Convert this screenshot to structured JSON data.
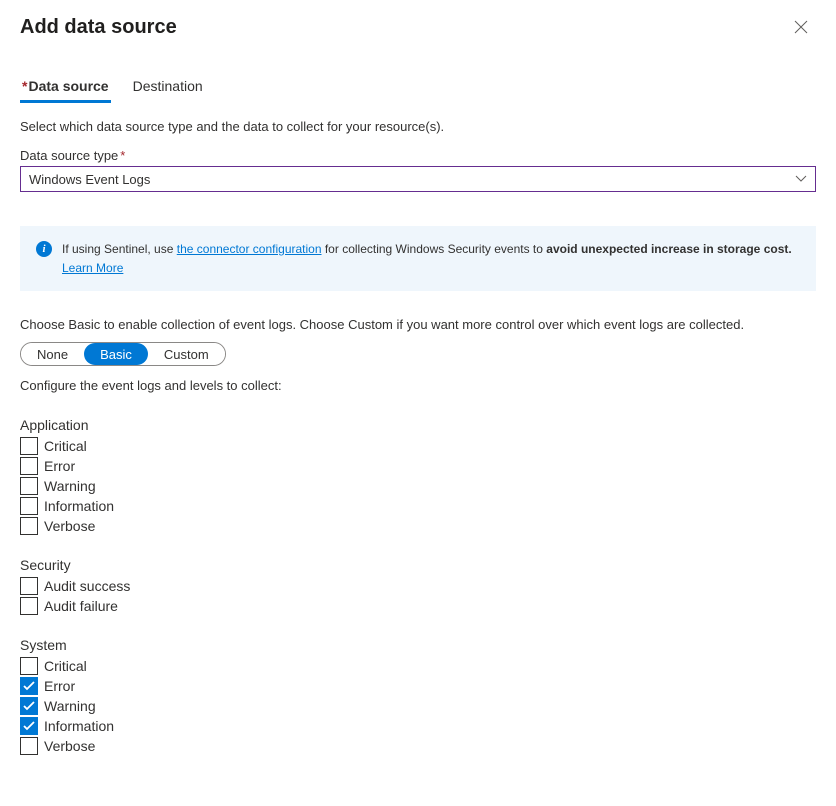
{
  "title": "Add data source",
  "tabs": {
    "data_source": "Data source",
    "destination": "Destination"
  },
  "helper_text": "Select which data source type and the data to collect for your resource(s).",
  "field_label": "Data source type",
  "required_mark": "*",
  "select_value": "Windows Event Logs",
  "info": {
    "prefix": "If using Sentinel, use ",
    "link": "the connector configuration",
    "mid": " for collecting Windows Security events to ",
    "bold": "avoid unexpected increase in storage cost.",
    "learn": "Learn More"
  },
  "mode_text": "Choose Basic to enable collection of event logs. Choose Custom if you want more control over which event logs are collected.",
  "modes": {
    "none": "None",
    "basic": "Basic",
    "custom": "Custom"
  },
  "config_text": "Configure the event logs and levels to collect:",
  "groups": [
    {
      "name": "Application",
      "items": [
        {
          "label": "Critical",
          "checked": false
        },
        {
          "label": "Error",
          "checked": false
        },
        {
          "label": "Warning",
          "checked": false
        },
        {
          "label": "Information",
          "checked": false
        },
        {
          "label": "Verbose",
          "checked": false
        }
      ]
    },
    {
      "name": "Security",
      "items": [
        {
          "label": "Audit success",
          "checked": false
        },
        {
          "label": "Audit failure",
          "checked": false
        }
      ]
    },
    {
      "name": "System",
      "items": [
        {
          "label": "Critical",
          "checked": false
        },
        {
          "label": "Error",
          "checked": true
        },
        {
          "label": "Warning",
          "checked": true
        },
        {
          "label": "Information",
          "checked": true
        },
        {
          "label": "Verbose",
          "checked": false
        }
      ]
    }
  ]
}
